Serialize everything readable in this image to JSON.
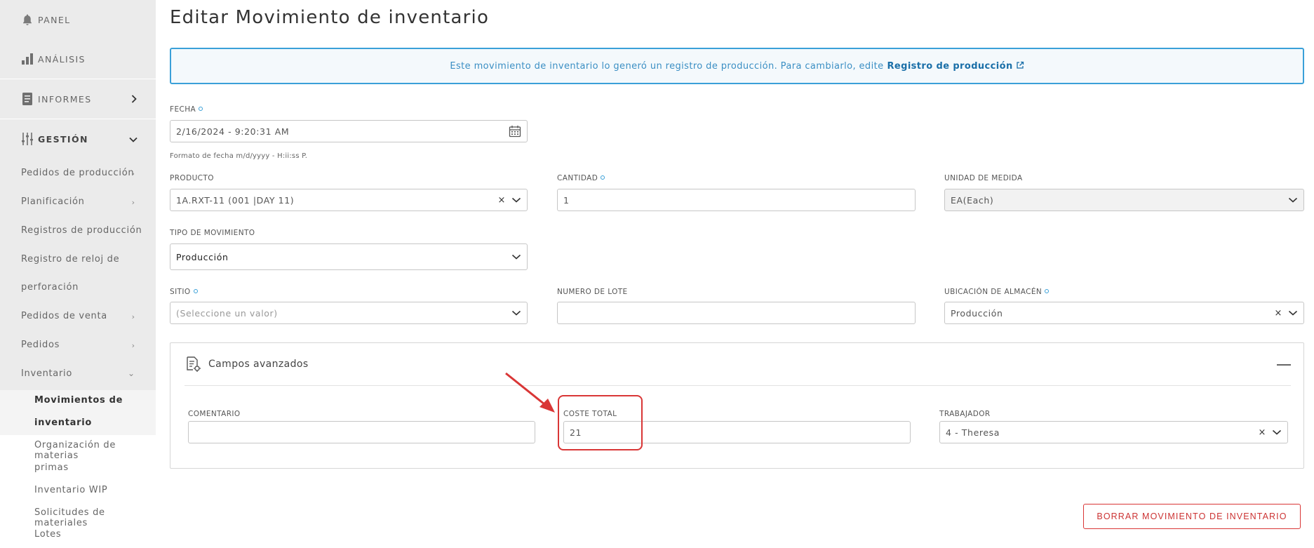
{
  "sidebar": {
    "panel_label": "PANEL",
    "analisis_label": "ANÁLISIS",
    "informes_label": "INFORMES",
    "gestion_label": "GESTIÓN",
    "items": [
      {
        "label": "Pedidos de producción"
      },
      {
        "label": "Planificación"
      },
      {
        "label": "Registros de producción"
      },
      {
        "label": "Registro de reloj de"
      },
      {
        "label": "perforación"
      },
      {
        "label": "Pedidos de venta"
      },
      {
        "label": "Pedidos"
      },
      {
        "label": "Inventario"
      }
    ],
    "subitems": [
      {
        "label": "Movimientos de"
      },
      {
        "label": "inventario"
      },
      {
        "label": "Organización de materias"
      },
      {
        "label": "primas"
      },
      {
        "label": "Inventario WIP"
      },
      {
        "label": "Solicitudes de materiales"
      },
      {
        "label": "Lotes"
      }
    ]
  },
  "page": {
    "title": "Editar Movimiento de inventario"
  },
  "banner": {
    "text": "Este movimiento de inventario lo generó un registro de producción. Para cambiarlo, edite",
    "link": "Registro de producción"
  },
  "form": {
    "fecha": {
      "label": "FECHA",
      "value": "2/16/2024 - 9:20:31 AM",
      "hint": "Formato de fecha m/d/yyyy - H:ii:ss P."
    },
    "producto": {
      "label": "PRODUCTO",
      "value": "1A.RXT-11 (001 |DAY 11)"
    },
    "cantidad": {
      "label": "CANTIDAD",
      "value": "1"
    },
    "unidad": {
      "label": "UNIDAD DE MEDIDA",
      "value": "EA(Each)"
    },
    "tipo": {
      "label": "TIPO DE MOVIMIENTO",
      "value": "Producción"
    },
    "sitio": {
      "label": "SITIO",
      "placeholder": "(Seleccione un valor)"
    },
    "lote": {
      "label": "NUMERO DE LOTE",
      "value": ""
    },
    "ubicacion": {
      "label": "UBICACIÓN DE ALMACÉN",
      "value": "Producción"
    }
  },
  "advanced": {
    "title": "Campos avanzados",
    "comentario": {
      "label": "COMENTARIO",
      "value": ""
    },
    "coste": {
      "label": "COSTE TOTAL",
      "value": "21"
    },
    "trabajador": {
      "label": "TRABAJADOR",
      "value": "4 - Theresa"
    }
  },
  "actions": {
    "delete_label": "BORRAR MOVIMIENTO DE INVENTARIO"
  },
  "colors": {
    "accent": "#3aa0d8",
    "danger": "#d93636",
    "sidebar_bg": "#ebebeb"
  }
}
